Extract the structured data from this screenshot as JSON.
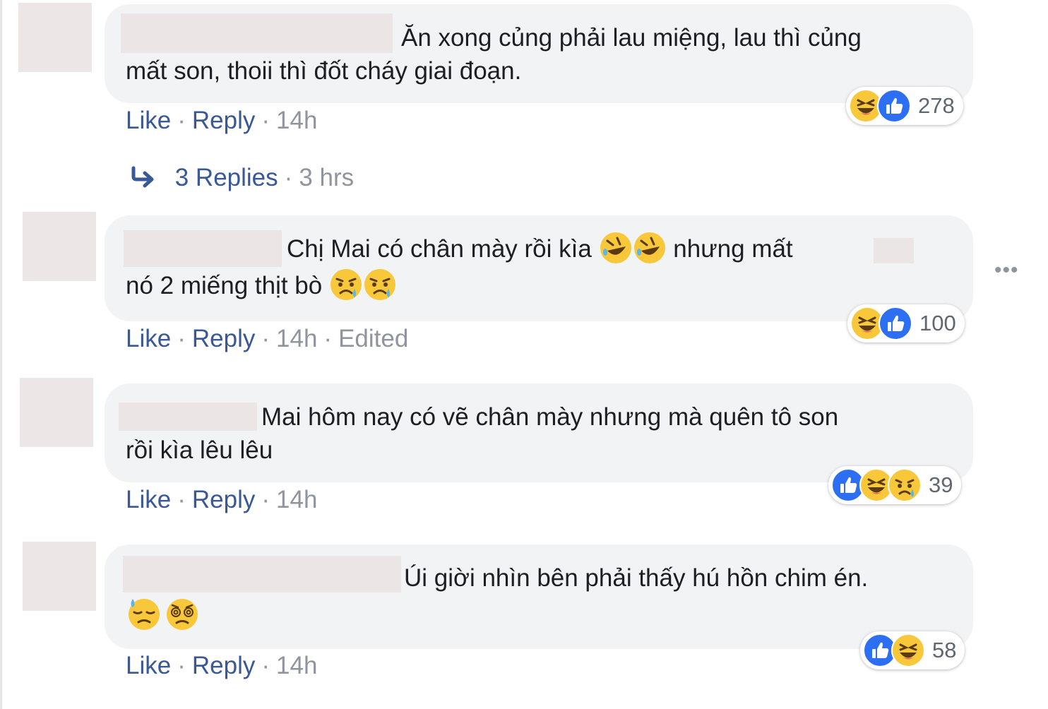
{
  "actions": {
    "like": "Like",
    "reply": "Reply",
    "edited": "Edited",
    "dot": "·"
  },
  "comments": [
    {
      "line1": "Ăn xong củng phải lau miệng, lau thì củng",
      "line2": "mất son, thoii thì đốt cháy giai đoạn.",
      "time": "14h",
      "reactions": [
        "haha",
        "like"
      ],
      "reaction_count": "278"
    },
    {
      "line1_a": "Chị Mai có chân mày rồi kìa",
      "line1_b": "nhưng mất",
      "line2": "nó 2 miếng thịt bò",
      "emojis_line1": [
        "rofl-emoji",
        "rofl-emoji"
      ],
      "emojis_line2": [
        "sad-tear-emoji",
        "sad-tear-emoji"
      ],
      "time": "14h",
      "reactions": [
        "haha",
        "like"
      ],
      "reaction_count": "100"
    },
    {
      "line1": "Mai hôm nay có vẽ chân mày nhưng mà quên tô son",
      "line2": "rồi kìa lêu lêu",
      "time": "14h",
      "reactions": [
        "like",
        "haha",
        "sad"
      ],
      "reaction_count": "39"
    },
    {
      "line1": "Úi giời nhìn bên phải thấy hú hồn chim én.",
      "emojis_line2": [
        "downcast-sweat-emoji",
        "dizzy-face-emoji"
      ],
      "time": "14h",
      "reactions": [
        "like",
        "haha"
      ],
      "reaction_count": "58"
    }
  ],
  "replies": {
    "label": "3 Replies",
    "time": "3 hrs"
  },
  "more_menu": {
    "label": "•••"
  },
  "colors": {
    "link": "#385898",
    "meta": "#90949c",
    "bubble": "#f2f3f5",
    "like_blue": "#2d6ff2",
    "emoji_yellow": "#f8c73a"
  }
}
